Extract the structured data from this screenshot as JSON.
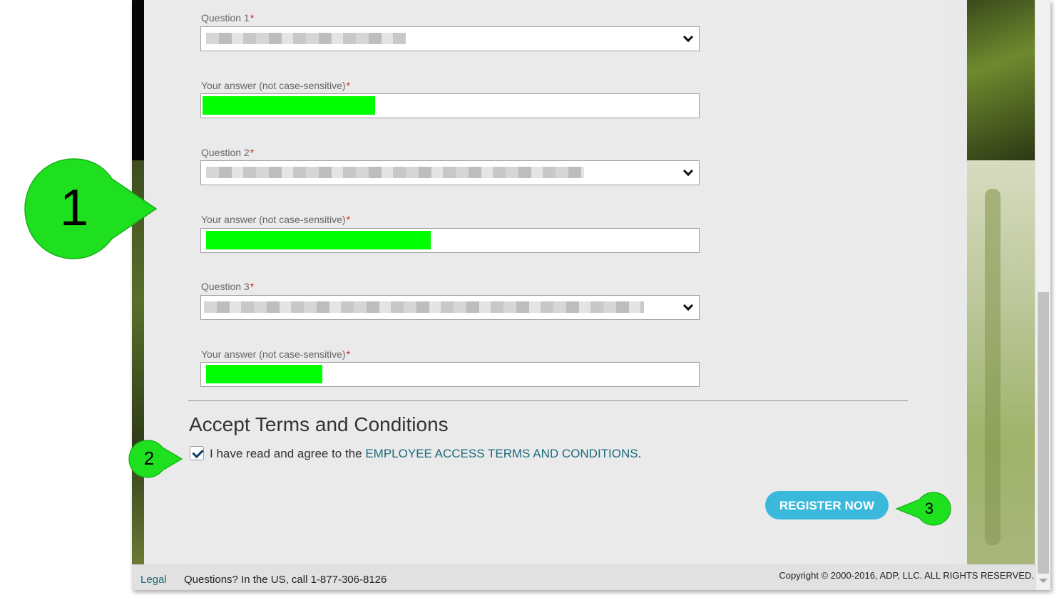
{
  "questions": [
    {
      "label": "Question 1",
      "answer_label": "Your answer (not case-sensitive)"
    },
    {
      "label": "Question 2",
      "answer_label": "Your answer (not case-sensitive)"
    },
    {
      "label": "Question 3",
      "answer_label": "Your answer (not case-sensitive)"
    }
  ],
  "required_mark": "*",
  "terms": {
    "heading": "Accept Terms and Conditions",
    "checked": true,
    "text": "I have read and agree to the",
    "link": "EMPLOYEE ACCESS TERMS AND CONDITIONS",
    "period": "."
  },
  "register_button": "REGISTER NOW",
  "footer": {
    "legal": "Legal",
    "questions": "Questions? In the US, call 1-877-306-8126",
    "copyright": "Copyright © 2000-2016, ADP, LLC. ALL RIGHTS RESERVED."
  },
  "callouts": [
    "1",
    "2",
    "3"
  ],
  "colors": {
    "callout_green": "#1ee01e",
    "redaction_green": "#00ff00",
    "button_blue": "#3ab9dd",
    "link_teal": "#1b6a7d",
    "required_red": "#d61e1e"
  }
}
